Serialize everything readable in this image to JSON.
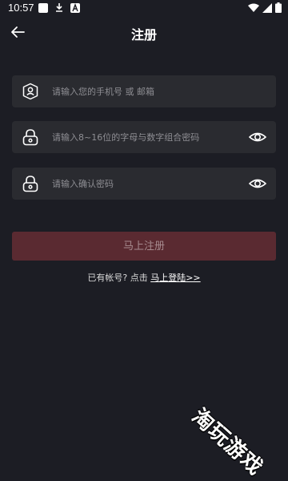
{
  "status_bar": {
    "time": "10:57",
    "icons": [
      "notification-square-icon",
      "download-icon",
      "a-badge-icon",
      "wifi-icon",
      "signal-icon",
      "battery-icon"
    ]
  },
  "header": {
    "title": "注册",
    "back_icon": "arrow-left-icon"
  },
  "form": {
    "account_placeholder": "请输入您的手机号 或 邮箱",
    "password_placeholder": "请输入8~16位的字母与数字组合密码",
    "confirm_placeholder": "请输入确认密码",
    "account_icon": "user-shield-icon",
    "lock_icon": "lock-icon",
    "eye_icon": "eye-icon"
  },
  "register_button": "马上注册",
  "login_prompt": {
    "text": "已有帐号? 点击",
    "link": "马上登陆>>"
  },
  "watermark": "淘玩游戏",
  "colors": {
    "background": "#1c1d24",
    "field": "#2a2b30",
    "button": "#5a2a31",
    "button_text": "#a78b8f"
  }
}
